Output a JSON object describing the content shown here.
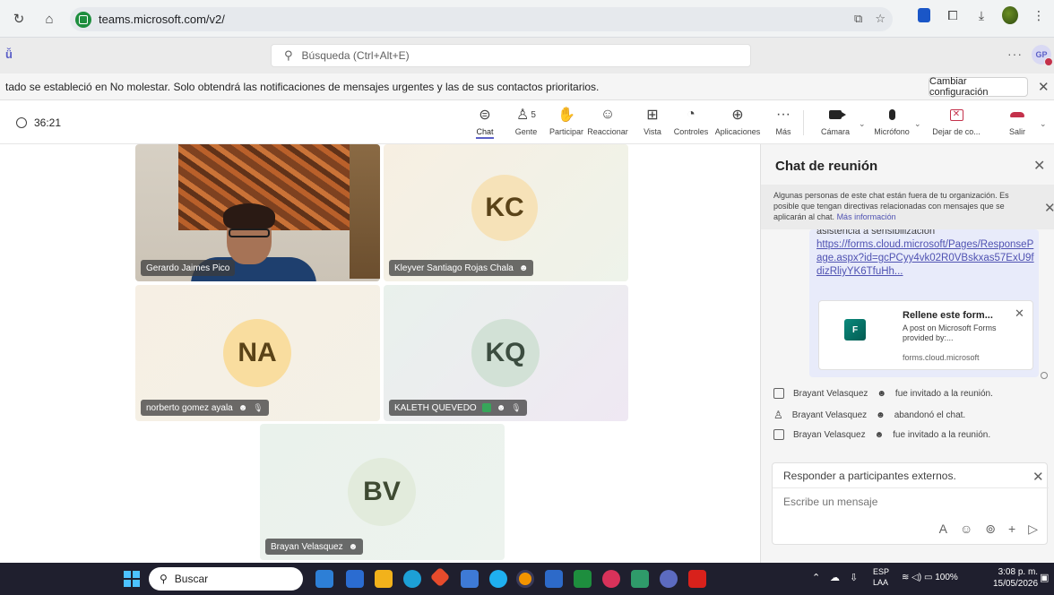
{
  "browser": {
    "url": "teams.microsoft.com/v2/"
  },
  "teams": {
    "search_placeholder": "Búsqueda (Ctrl+Alt+E)",
    "more": "···",
    "user_initials": "GP"
  },
  "notification": {
    "text": "tado se estableció en No molestar. Solo obtendrá las notificaciones de mensajes urgentes y las de sus contactos prioritarios.",
    "button": "Cambiar configuración"
  },
  "toolbar": {
    "timer": "36:21",
    "people_count": "5",
    "items": [
      {
        "label": "Chat"
      },
      {
        "label": "Gente"
      },
      {
        "label": "Participar"
      },
      {
        "label": "Reaccionar"
      },
      {
        "label": "Vista"
      },
      {
        "label": "Controles"
      },
      {
        "label": "Aplicaciones"
      },
      {
        "label": "Más"
      },
      {
        "label": "Cámara"
      },
      {
        "label": "Micrófono"
      },
      {
        "label": "Dejar de co..."
      },
      {
        "label": "Salir"
      }
    ]
  },
  "participants": [
    {
      "name": "Gerardo Jaimes Pico",
      "initials": "",
      "video": true
    },
    {
      "name": "Kleyver Santiago Rojas Chala",
      "initials": "KC"
    },
    {
      "name": "norberto gomez ayala",
      "initials": "NA"
    },
    {
      "name": "KALETH QUEVEDO",
      "initials": "KQ"
    },
    {
      "name": "Brayan Velasquez",
      "initials": "BV"
    }
  ],
  "chat": {
    "title": "Chat de reunión",
    "warning": "Algunas personas de este chat están fuera de tu organización. Es posible que tengan directivas relacionadas con mensajes que se aplicarán al chat.",
    "warning_link": "Más información",
    "partial_text": "asistencia a sensibilización",
    "link": "https://forms.cloud.microsoft/Pages/ResponsePage.aspx?id=gcPCyy4vk02R0VBskxas57ExU9fdizRliyYK6TfuHh...",
    "card": {
      "title": "Rellene este form...",
      "desc": "A post on Microsoft Forms provided by:...",
      "domain": "forms.cloud.microsoft"
    },
    "events": [
      {
        "name": "Brayant Velasquez",
        "text": "fue invitado a la reunión."
      },
      {
        "name": "Brayant Velasquez",
        "text": "abandonó el chat."
      },
      {
        "name": "Brayan Velasquez",
        "text": "fue invitado a la reunión."
      }
    ],
    "reply_header": "Responder a participantes externos.",
    "reply_placeholder": "Escribe un mensaje"
  },
  "taskbar": {
    "search": "Buscar",
    "lang_top": "ESP",
    "lang_bottom": "LAA",
    "battery": "100%",
    "time": "3:08 p. m.",
    "date": "15/05/2026"
  }
}
